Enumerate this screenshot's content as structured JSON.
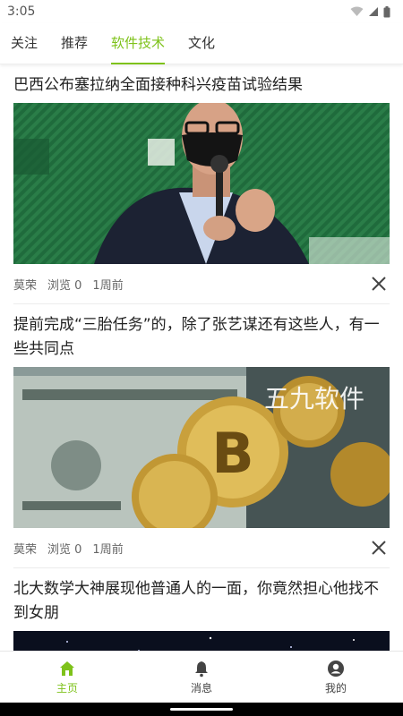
{
  "status_bar": {
    "time": "3:05",
    "icons": [
      "wifi-icon",
      "signal-icon",
      "battery-icon"
    ]
  },
  "tabs": [
    {
      "label": "关注",
      "active": false
    },
    {
      "label": "推荐",
      "active": false
    },
    {
      "label": "软件技术",
      "active": true
    },
    {
      "label": "文化",
      "active": false
    }
  ],
  "articles": [
    {
      "title": "巴西公布塞拉纳全面接种科兴疫苗试验结果",
      "image": "man-in-mask-speaking-photo",
      "author": "莫荣",
      "views": "浏览 0",
      "time": "1周前"
    },
    {
      "title": "提前完成“三胎任务”的，除了张艺谋还有这些人，有一些共同点",
      "image": "bitcoin-on-dollars-photo",
      "watermark": "五九软件",
      "author": "莫荣",
      "views": "浏览 0",
      "time": "1周前"
    },
    {
      "title": "北大数学大神展现他普通人的一面，你竟然担心他找不到女朋",
      "image": "night-sky-photo"
    }
  ],
  "bottom_nav": [
    {
      "label": "主页",
      "icon": "home-icon",
      "active": true
    },
    {
      "label": "消息",
      "icon": "bell-icon",
      "active": false
    },
    {
      "label": "我的",
      "icon": "profile-icon",
      "active": false
    }
  ],
  "colors": {
    "accent": "#7ec21a",
    "text": "#222222",
    "meta": "#666666"
  }
}
